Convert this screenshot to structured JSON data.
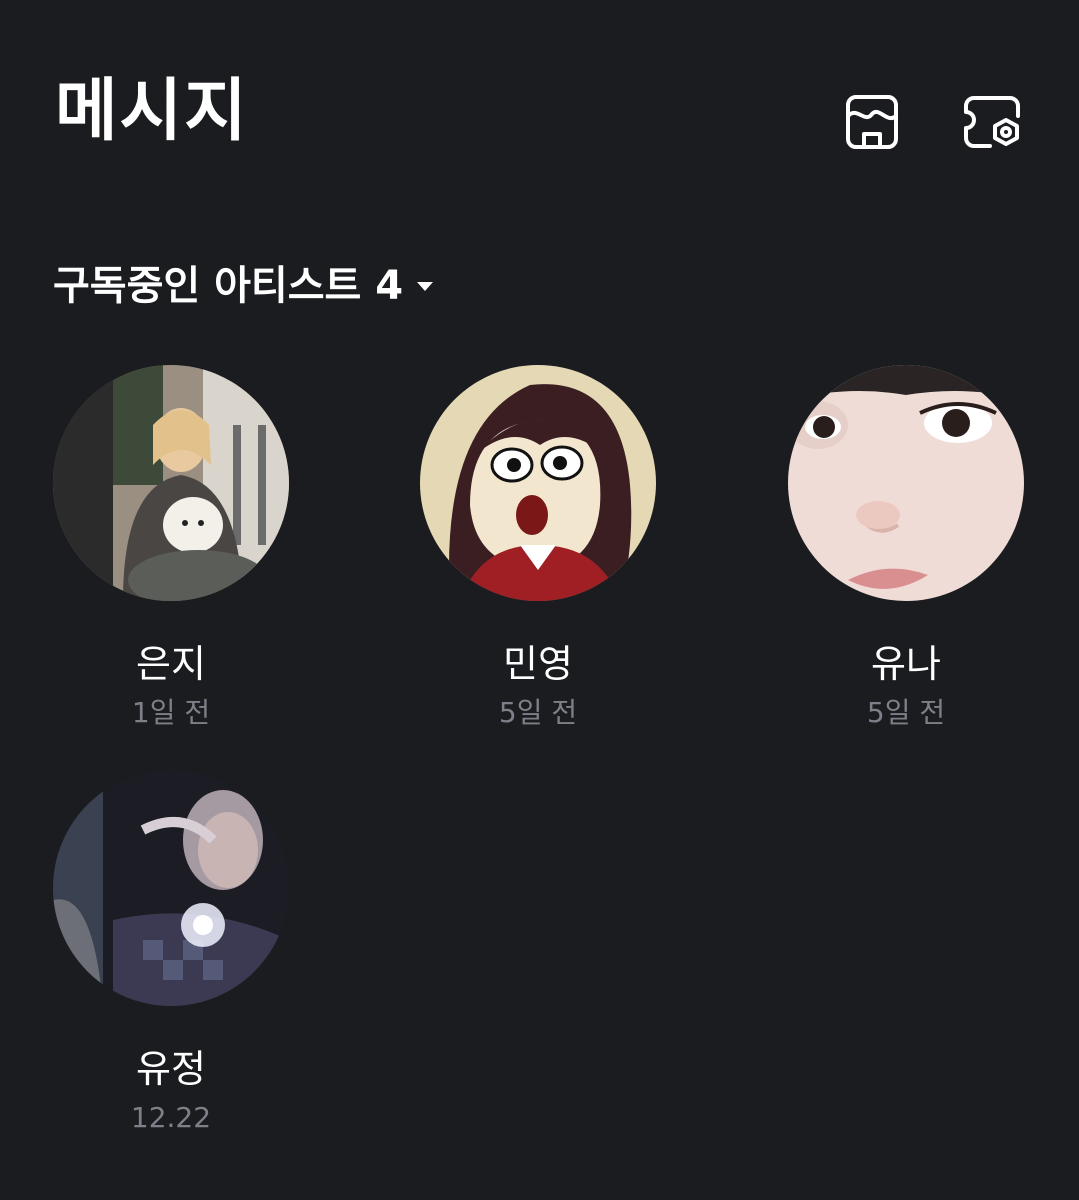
{
  "header": {
    "title": "메시지",
    "icons": [
      "store-icon",
      "ticket-settings-icon"
    ]
  },
  "section": {
    "title": "구독중인 아티스트 4",
    "caret_icon": "caret-down-icon"
  },
  "artists": [
    {
      "name": "은지",
      "time": "1일 전"
    },
    {
      "name": "민영",
      "time": "5일 전"
    },
    {
      "name": "유나",
      "time": "5일 전"
    },
    {
      "name": "유정",
      "time": "12.22"
    }
  ],
  "colors": {
    "background": "#1b1c20",
    "text_primary": "#ffffff",
    "text_secondary": "#7d8089"
  }
}
